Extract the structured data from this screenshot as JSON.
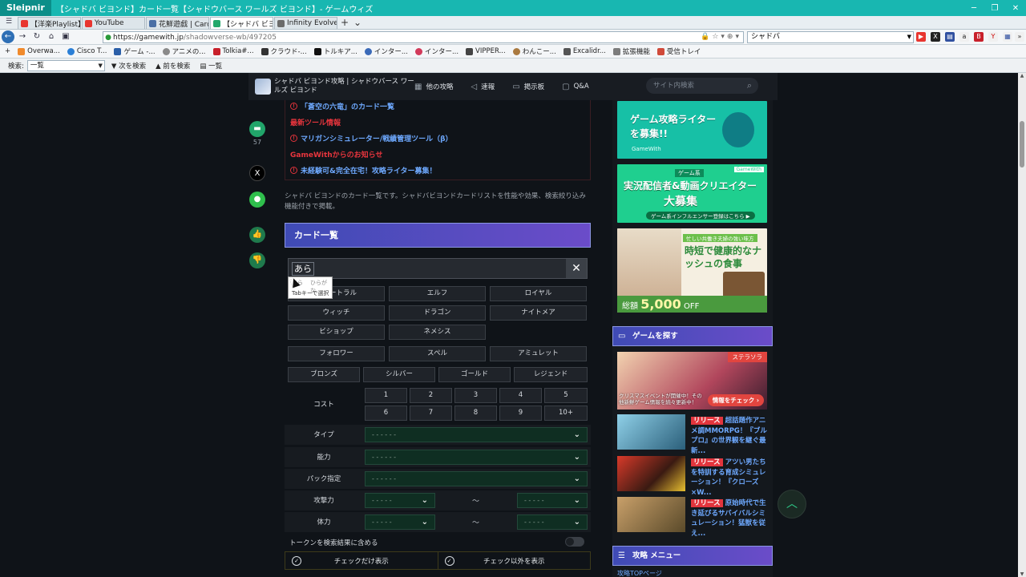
{
  "browser": {
    "app": "Sleipnir",
    "window_title": "【シャドバ ビヨンド】カード一覧【シャドウバース ワールズ ビヨンド】- ゲームウィズ",
    "tabs": [
      {
        "label": "【洋楽Playlist】...",
        "icon_color": "#e8352f"
      },
      {
        "label": "YouTube",
        "icon_color": "#e8352f"
      },
      {
        "label": "花鮮遊戯 | Card...",
        "icon_color": "#4a6fa5"
      },
      {
        "label": "【シャドバ ビヨンド】...",
        "icon_color": "#22a86b",
        "active": true
      },
      {
        "label": "Infinity Evolved ...",
        "icon_color": "#6b6b6b"
      }
    ],
    "new_tab": "+",
    "url_host": "https://gamewith.jp",
    "url_path": "/shadowverse-wb/497205",
    "search_value": "シャドバ",
    "bookmarks": [
      "Overwa...",
      "Cisco T...",
      "ゲーム -...",
      "アニメの...",
      "Tolkia#...",
      "クラウド-...",
      "トルキア...",
      "インター...",
      "インター...",
      "VIPPER...",
      "わんこー...",
      "Excalidr...",
      "拡張機能",
      "受信トレイ"
    ],
    "find": {
      "label": "検索:",
      "value": "一覧",
      "next": "次を検索",
      "prev": "前を検索",
      "page": "一覧"
    }
  },
  "site": {
    "name": "シャドバ ビヨンド攻略 | シャドウバース ワールズ ビヨンド",
    "nav": [
      {
        "icon": "grid-icon",
        "label": "他の攻略"
      },
      {
        "icon": "megaphone-icon",
        "label": "速報"
      },
      {
        "icon": "board-icon",
        "label": "掲示板"
      },
      {
        "icon": "qa-icon",
        "label": "Q&A"
      }
    ],
    "search_placeholder": "サイト内検索"
  },
  "notices": [
    {
      "text": "「蒼空の六竜」のカード一覧",
      "color": "blue",
      "icon": true
    },
    {
      "text": "最新ツール情報",
      "color": "red",
      "icon": false
    },
    {
      "text": "マリガンシミュレーター/戦績管理ツール（β）",
      "color": "blue",
      "icon": true
    },
    {
      "text": "GameWithからのお知らせ",
      "color": "red",
      "icon": false
    },
    {
      "text": "未経験可&完全在宅！攻略ライター募集！",
      "color": "blue",
      "icon": true
    }
  ],
  "share": {
    "comment_count": "57"
  },
  "intro": "シャドバ ビヨンドのカード一覧です。シャドバビヨンドカードリストを性能や効果、検索絞り込み機能付きで掲載。",
  "section_title": "カード一覧",
  "search": {
    "value": "あら",
    "clear": "✕",
    "ime_reading": "あら",
    "ime_type": "ひらがな",
    "ime_hint": "Tabキーで選択"
  },
  "classes": [
    "ニュートラル",
    "エルフ",
    "ロイヤル",
    "ウィッチ",
    "ドラゴン",
    "ナイトメア",
    "ビショップ",
    "ネメシス"
  ],
  "types": [
    "フォロワー",
    "スペル",
    "アミュレット"
  ],
  "rarities": [
    "ブロンズ",
    "シルバー",
    "ゴールド",
    "レジェンド"
  ],
  "cost": {
    "label": "コスト",
    "values": [
      "1",
      "2",
      "3",
      "4",
      "5",
      "6",
      "7",
      "8",
      "9",
      "10+"
    ]
  },
  "filters": {
    "type_label": "タイプ",
    "ability_label": "能力",
    "pack_label": "パック指定",
    "attack_label": "攻撃力",
    "hp_label": "体力",
    "placeholder": "- - - - - -",
    "range_placeholder": "- - - - -",
    "tilde": "〜"
  },
  "token_toggle": "トークンを検索結果に含める",
  "check_buttons": [
    "チェックだけ表示",
    "チェック以外を表示"
  ],
  "sidebar": {
    "ad1": {
      "title": "ゲーム攻略ライターを募集!!",
      "brand": "GameWith"
    },
    "ad2": {
      "tag": "GameWith",
      "pre": "ゲーム系",
      "title1": "実況配信者&動画クリエイター",
      "title2": "大募集",
      "sub": "ゲーム系インフルエンサー登録はこちら ▶"
    },
    "ad3": {
      "tag": "忙しい共働き夫婦の強い味方",
      "title": "時短で健康的なナッシュの食事",
      "price_prefix": "総額",
      "price": "5,000",
      "price_suffix": "OFF"
    },
    "find_game": "ゲームを探す",
    "banner": {
      "tag": "ステラソラ",
      "caption": "クリスマスイベントが開催中！その他新鮮ゲーム情報を続々更新中！",
      "cta": "情報をチェック"
    },
    "games": [
      {
        "badge": "リリース",
        "text": "超話題作アニメ調MMORPG！『ブルプロ』の世界観を継ぐ最新..."
      },
      {
        "badge": "リリース",
        "text": "アツい男たちを特訓する育成シミュレーション！『クローズ×W..."
      },
      {
        "badge": "リリース",
        "text": "原始時代で生き延びるサバイバルシミュレーション！猛獣を従え..."
      }
    ],
    "menu_title": "攻略 メニュー",
    "peek": "攻略TOPページ"
  }
}
